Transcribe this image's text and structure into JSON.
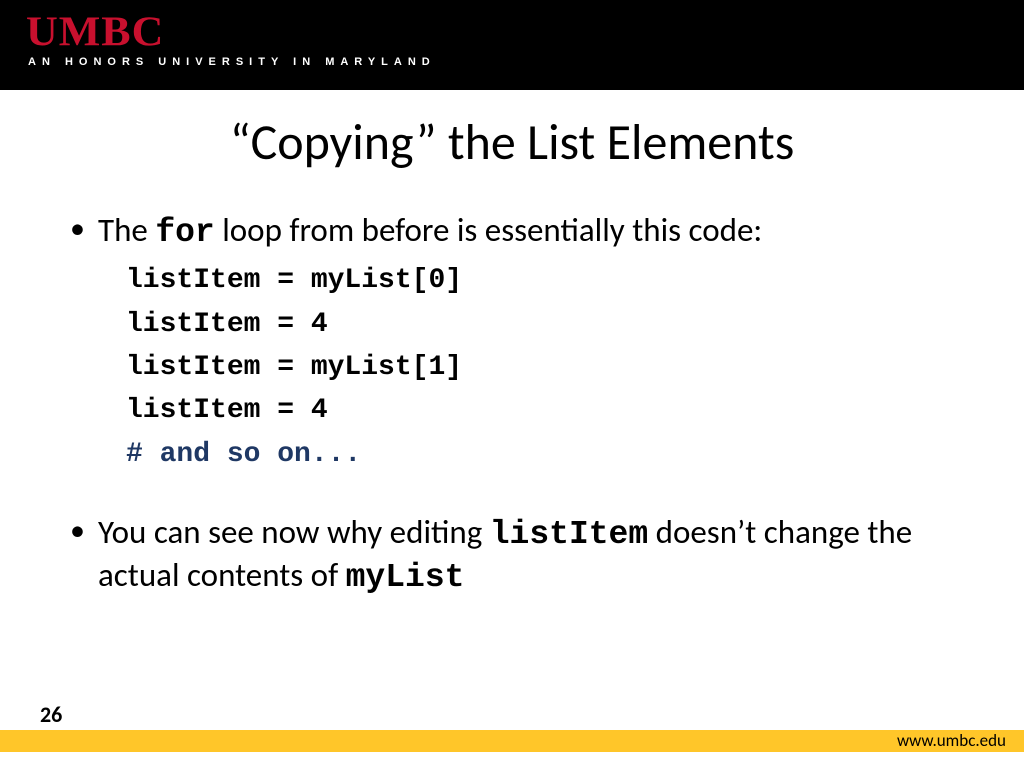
{
  "header": {
    "logo": "UMBC",
    "tagline": "AN  HONORS  UNIVERSITY  IN  MARYLAND"
  },
  "title": "“Copying” the List Elements",
  "bullet1": {
    "pre": "The ",
    "mono": "for",
    "post": " loop from before is essentially this code:"
  },
  "code": {
    "l1": "listItem = myList[0]",
    "l2": "listItem = 4",
    "l3": "listItem = myList[1]",
    "l4": "listItem = 4",
    "l5": "# and so on..."
  },
  "bullet2": {
    "p1": "You can see now why editing ",
    "m1": "listItem",
    "p2": " doesn’t change the actual contents of ",
    "m2": "myList"
  },
  "footer": {
    "page": "26",
    "url": "www.umbc.edu"
  }
}
